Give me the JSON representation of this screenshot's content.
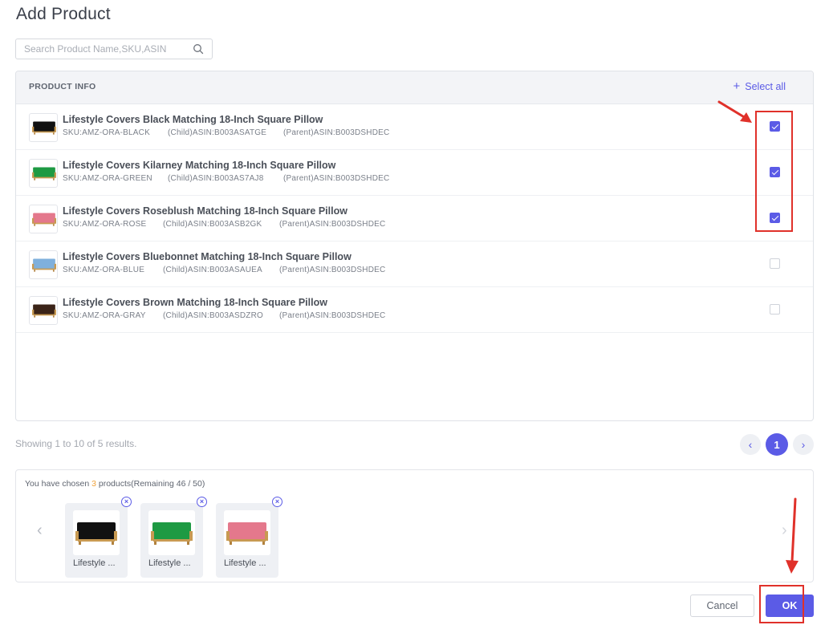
{
  "dialog": {
    "title": "Add Product"
  },
  "search": {
    "placeholder": "Search Product Name,SKU,ASIN",
    "icon": "search-icon"
  },
  "table": {
    "header": "PRODUCT INFO",
    "select_all": "Select all",
    "rows": [
      {
        "name": "Lifestyle Covers Black Matching 18-Inch Square Pillow",
        "sku": "SKU:AMZ-ORA-BLACK",
        "child": "(Child)ASIN:B003ASATGE",
        "parent": "(Parent)ASIN:B003DSHDEC",
        "checked": true,
        "color": "#111111"
      },
      {
        "name": "Lifestyle Covers Kilarney Matching 18-Inch Square Pillow",
        "sku": "SKU:AMZ-ORA-GREEN",
        "child": "(Child)ASIN:B003AS7AJ8",
        "parent": "(Parent)ASIN:B003DSHDEC",
        "checked": true,
        "color": "#1e9a43"
      },
      {
        "name": "Lifestyle Covers Roseblush Matching 18-Inch Square Pillow",
        "sku": "SKU:AMZ-ORA-ROSE",
        "child": "(Child)ASIN:B003ASB2GK",
        "parent": "(Parent)ASIN:B003DSHDEC",
        "checked": true,
        "color": "#e4788c"
      },
      {
        "name": "Lifestyle Covers Bluebonnet Matching 18-Inch Square Pillow",
        "sku": "SKU:AMZ-ORA-BLUE",
        "child": "(Child)ASIN:B003ASAUEA",
        "parent": "(Parent)ASIN:B003DSHDEC",
        "checked": false,
        "color": "#7fb0dc"
      },
      {
        "name": "Lifestyle Covers Brown Matching 18-Inch Square Pillow",
        "sku": "SKU:AMZ-ORA-GRAY",
        "child": "(Child)ASIN:B003ASDZRO",
        "parent": "(Parent)ASIN:B003DSHDEC",
        "checked": false,
        "color": "#3b2418"
      }
    ]
  },
  "pagination": {
    "showing": "Showing 1 to 10 of 5 results.",
    "current_page": "1",
    "prev": "‹",
    "next": "›"
  },
  "chosen": {
    "prefix": "You have chosen ",
    "count": "3",
    "suffix": " products(Remaining 46 / 50)",
    "items": [
      {
        "label": "Lifestyle ...",
        "color": "#111111"
      },
      {
        "label": "Lifestyle ...",
        "color": "#1e9a43"
      },
      {
        "label": "Lifestyle ...",
        "color": "#e4788c"
      }
    ],
    "remove_glyph": "×",
    "prev": "‹",
    "next": "›"
  },
  "footer": {
    "cancel": "Cancel",
    "ok": "OK"
  },
  "colors": {
    "accent": "#5b5be6",
    "annotation": "#e0312a",
    "count": "#f0a23a"
  }
}
